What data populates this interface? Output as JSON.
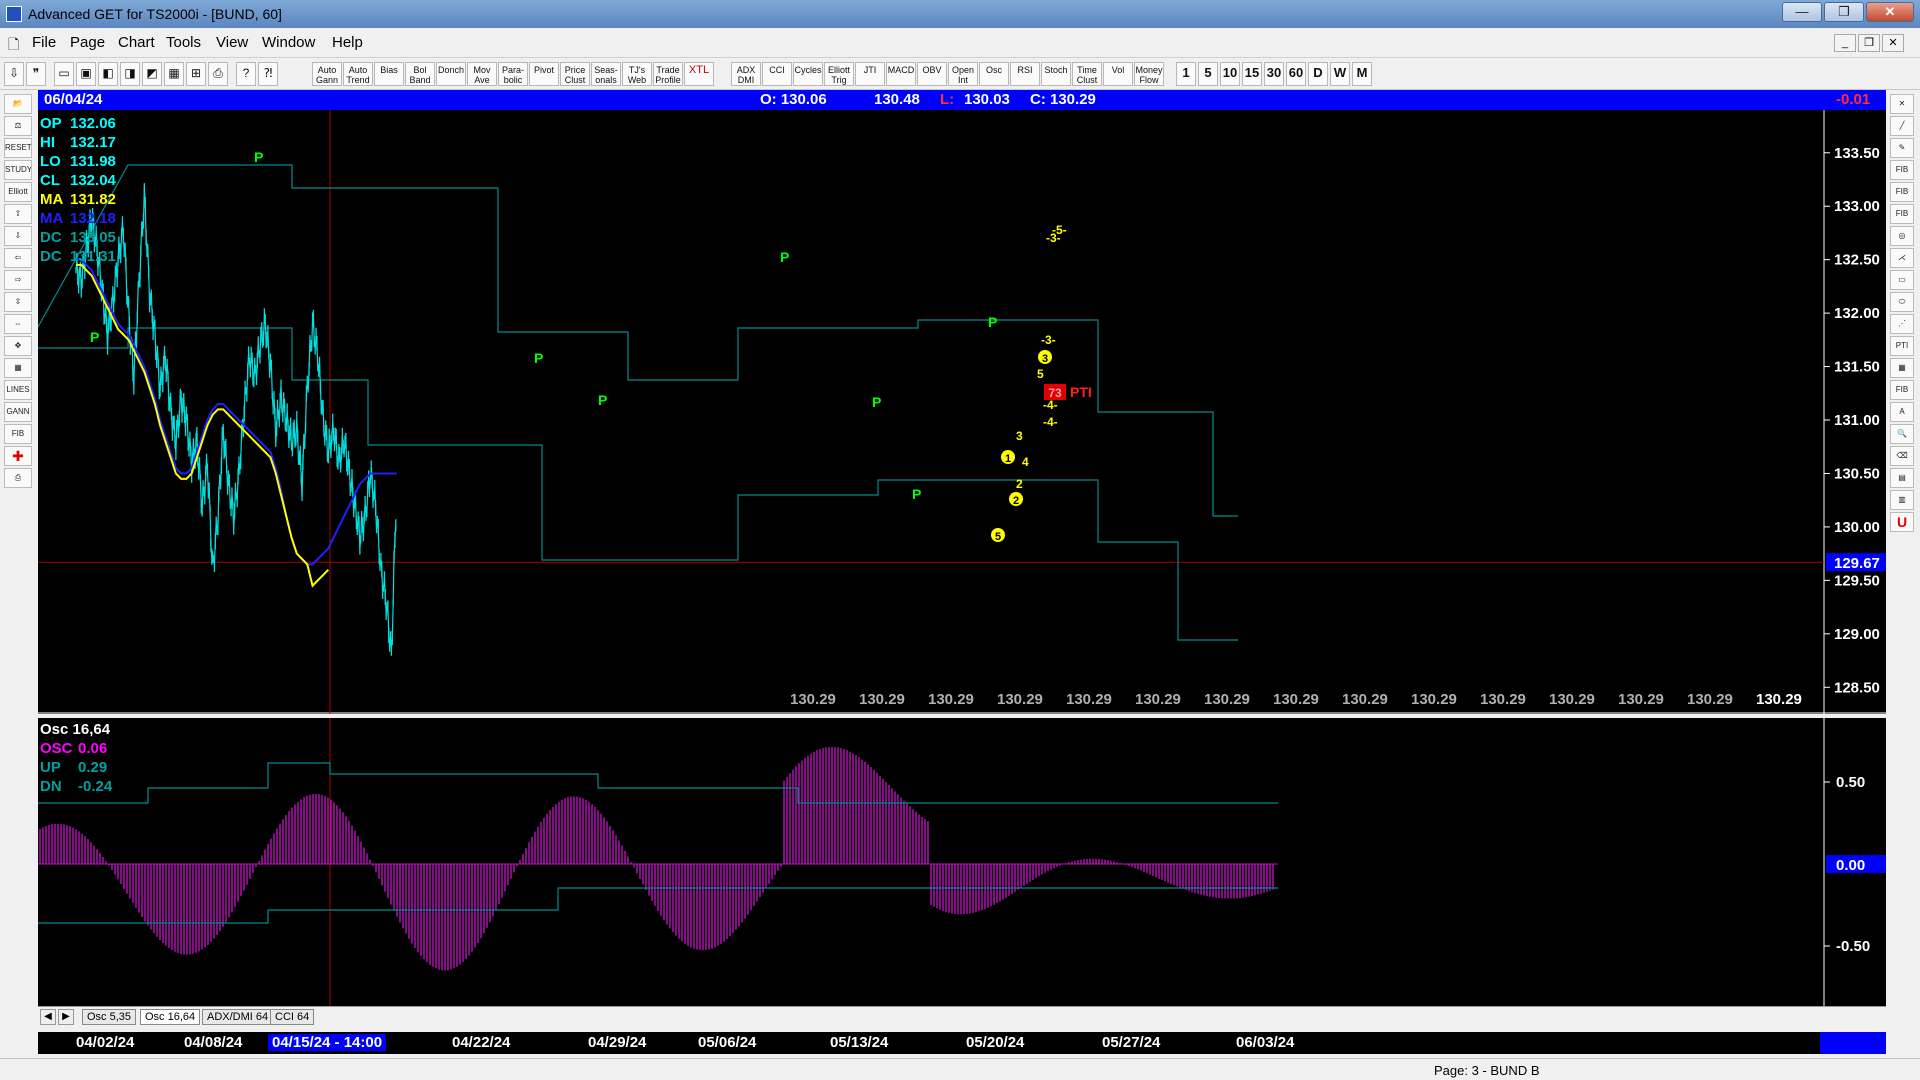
{
  "window": {
    "title": "Advanced GET for TS2000i - [BUND, 60]"
  },
  "menu": [
    "File",
    "Page",
    "Chart",
    "Tools",
    "View",
    "Window",
    "Help"
  ],
  "toolbar": {
    "studies": [
      [
        "Auto",
        "Gann"
      ],
      [
        "Auto",
        "Trend"
      ],
      [
        "Bias",
        ""
      ],
      [
        "Bol",
        "Band"
      ],
      [
        "Donch",
        ""
      ],
      [
        "Mov",
        "Ave"
      ],
      [
        "Para-",
        "bolic"
      ],
      [
        "Pivot",
        ""
      ],
      [
        "Price",
        "Clust"
      ],
      [
        "Seas-",
        "onals"
      ],
      [
        "TJ's",
        "Web"
      ],
      [
        "Trade",
        "Profile"
      ],
      [
        "XTL",
        ""
      ],
      [
        "ADX",
        "DMI"
      ],
      [
        "CCI",
        ""
      ],
      [
        "Cycles",
        ""
      ],
      [
        "Elliott",
        "Trig"
      ],
      [
        "JTI",
        ""
      ],
      [
        "MACD",
        ""
      ],
      [
        "OBV",
        ""
      ],
      [
        "Open",
        "Int"
      ],
      [
        "Osc",
        ""
      ],
      [
        "RSI",
        ""
      ],
      [
        "Stoch",
        ""
      ],
      [
        "Time",
        "Clust"
      ],
      [
        "Vol",
        ""
      ],
      [
        "Money",
        "Flow"
      ]
    ],
    "periods": [
      "1",
      "5",
      "10",
      "15",
      "30",
      "60",
      "D",
      "W",
      "M"
    ]
  },
  "infobar": {
    "date": "06/04/24",
    "open": "O: 130.06",
    "high": "130.48",
    "low_label": "L:",
    "low": "130.03",
    "close": "C: 130.29",
    "change": "-0.01"
  },
  "main_chart": {
    "legend": [
      {
        "label": "OP",
        "value": "132.06",
        "color": "#00ffff"
      },
      {
        "label": "HI",
        "value": "132.17",
        "color": "#00ffff"
      },
      {
        "label": "LO",
        "value": "131.98",
        "color": "#00ffff"
      },
      {
        "label": "CL",
        "value": "132.04",
        "color": "#00ffff"
      },
      {
        "label": "MA",
        "value": "131.82",
        "color": "#ffff00"
      },
      {
        "label": "MA",
        "value": "132.18",
        "color": "#2020ff"
      },
      {
        "label": "DC",
        "value": "133.05",
        "color": "#00a0a0"
      },
      {
        "label": "DC",
        "value": "131.31",
        "color": "#00a0a0"
      }
    ],
    "y_ticks": [
      "133.50",
      "133.00",
      "132.50",
      "132.00",
      "131.50",
      "131.00",
      "130.50",
      "130.00",
      "129.50",
      "129.00",
      "128.50"
    ],
    "current_price": "129.67",
    "bottom_value": "130.29",
    "pivot_label": "P",
    "pti": {
      "value": "73",
      "label": "PTI"
    },
    "wave_labels": [
      "3",
      "5",
      "1",
      "2",
      "5",
      "-3-",
      "-4-",
      "-4-",
      "3",
      "4",
      "2",
      "-5-",
      "-3-"
    ]
  },
  "osc_chart": {
    "legend": [
      {
        "label": "Osc 16,64",
        "value": "",
        "color": "#ffffff"
      },
      {
        "label": "OSC",
        "value": "0.06",
        "color": "#ff00ff"
      },
      {
        "label": "UP",
        "value": "0.29",
        "color": "#00a0a0"
      },
      {
        "label": "DN",
        "value": "-0.24",
        "color": "#00a0a0"
      }
    ],
    "y_ticks": [
      "0.50",
      "-0.50"
    ],
    "zero": "0.00"
  },
  "tabs": [
    "Osc 5,35",
    "Osc 16,64",
    "ADX/DMI 64",
    "CCI 64"
  ],
  "date_axis": [
    "04/02/24",
    "04/08/24",
    "04/15/24 - 14:00",
    "04/22/24",
    "04/29/24",
    "05/06/24",
    "05/13/24",
    "05/20/24",
    "05/27/24",
    "06/03/24"
  ],
  "status": "Page: 3 - BUND B",
  "chart_data": {
    "type": "line",
    "title": "",
    "xlabel": "",
    "ylabel": "",
    "ylim": [
      128.25,
      133.9
    ],
    "x": [
      0,
      3,
      6,
      9,
      12,
      15,
      18,
      21,
      24,
      27,
      30,
      33,
      36,
      39,
      42,
      45,
      48,
      51,
      54,
      57,
      60,
      63,
      66,
      69,
      72,
      75,
      78,
      81,
      84,
      87,
      90,
      93,
      96,
      99,
      102,
      105,
      108,
      111,
      114,
      117,
      120,
      123,
      126,
      129,
      132,
      135,
      138,
      141,
      144,
      147,
      150,
      153,
      156,
      159,
      162,
      165,
      168,
      171,
      174,
      177,
      180,
      183
    ],
    "series": [
      {
        "values": [
          132.4,
          132.3,
          132.6,
          132.9,
          132.6,
          132.2,
          131.8,
          132.1,
          132.5,
          132.8,
          132.0,
          131.4,
          132.3,
          133.1,
          132.2,
          131.8,
          131.3,
          131.6,
          131.1,
          130.8,
          131.2,
          131.0,
          130.6,
          130.8,
          130.2,
          130.6,
          129.6,
          130.1,
          130.9,
          130.4,
          130.1,
          130.5,
          131.1,
          131.6,
          131.4,
          131.7,
          131.9,
          131.5,
          130.9,
          131.2,
          131.0,
          130.8,
          130.9,
          130.4,
          131.3,
          131.9,
          131.6,
          131.0,
          130.7,
          130.9,
          130.6,
          130.8,
          130.5,
          130.2,
          129.9,
          130.1,
          130.5,
          130.2,
          129.6,
          129.3,
          128.8,
          130.4
        ]
      },
      {
        "values": [
          132.5,
          132.5,
          132.45,
          132.4,
          132.3,
          132.2,
          132.1,
          132.0,
          131.9,
          131.85,
          131.8,
          131.7,
          131.6,
          131.5,
          131.35,
          131.2,
          131.0,
          130.85,
          130.7,
          130.55,
          130.5,
          130.5,
          130.55,
          130.7,
          130.85,
          131.0,
          131.1,
          131.15,
          131.15,
          131.1,
          131.05,
          131.0,
          130.95,
          130.9,
          130.85,
          130.8,
          130.75,
          130.7,
          130.55,
          130.35,
          130.1,
          129.9,
          129.75,
          129.7,
          129.65,
          129.65,
          129.7,
          129.75,
          129.8,
          129.9,
          130.0,
          130.1,
          130.2,
          130.3,
          130.4,
          130.45,
          130.5,
          130.5,
          130.5,
          130.5,
          130.5,
          130.5
        ]
      }
    ]
  }
}
